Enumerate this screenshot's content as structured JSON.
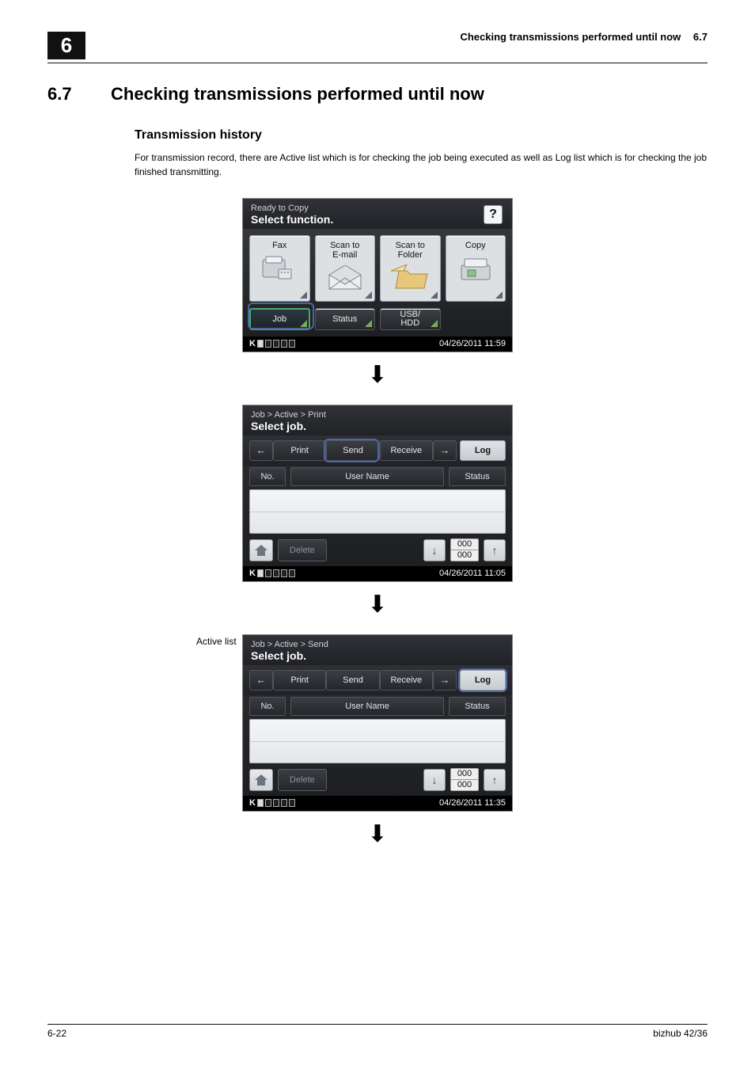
{
  "header": {
    "chapter_badge": "6",
    "running_title": "Checking transmissions performed until now",
    "running_section": "6.7"
  },
  "section": {
    "number": "6.7",
    "title": "Checking transmissions performed until now"
  },
  "subhead": "Transmission history",
  "paragraph": "For transmission record, there are Active list which is for checking the job being executed as well as Log list which is for checking the job finished transmitting.",
  "side_label": "Active list",
  "screen1": {
    "title_small": "Ready to Copy",
    "title_big": "Select function.",
    "help": "?",
    "tiles": {
      "fax": "Fax",
      "scan_email_l1": "Scan to",
      "scan_email_l2": "E-mail",
      "scan_folder_l1": "Scan to",
      "scan_folder_l2": "Folder",
      "copy": "Copy"
    },
    "small": {
      "job": "Job",
      "status": "Status",
      "usb_l1": "USB/",
      "usb_l2": "HDD"
    },
    "timestamp": "04/26/2011  11:59"
  },
  "screen2": {
    "breadcrumb": "Job > Active > Print",
    "title": "Select job.",
    "tabs": {
      "print": "Print",
      "send": "Send",
      "receive": "Receive",
      "log": "Log"
    },
    "cols": {
      "no": "No.",
      "user": "User Name",
      "status": "Status"
    },
    "delete": "Delete",
    "page_top": "000",
    "page_bottom": "000",
    "timestamp": "04/26/2011  11:05"
  },
  "screen3": {
    "breadcrumb": "Job > Active > Send",
    "title": "Select job.",
    "tabs": {
      "print": "Print",
      "send": "Send",
      "receive": "Receive",
      "log": "Log"
    },
    "cols": {
      "no": "No.",
      "user": "User Name",
      "status": "Status"
    },
    "delete": "Delete",
    "page_top": "000",
    "page_bottom": "000",
    "timestamp": "04/26/2011  11:35"
  },
  "toner_prefix": "K",
  "footer": {
    "left": "6-22",
    "right": "bizhub 42/36"
  }
}
